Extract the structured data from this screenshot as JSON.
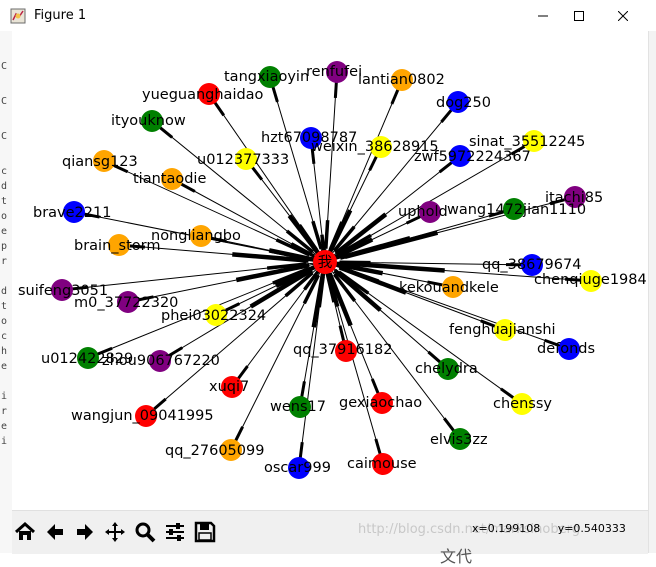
{
  "window": {
    "title": "Figure 1",
    "controls": {
      "minimize": "minimize",
      "maximize": "maximize",
      "close": "close"
    }
  },
  "left_strip_chars": [
    "C",
    "C",
    "C",
    "c",
    "d",
    "t",
    "o",
    "e",
    "p",
    "r",
    "d",
    "t",
    "o",
    "c",
    "h",
    "e",
    "i",
    "r",
    "e",
    "i"
  ],
  "graph": {
    "center": {
      "label": "我",
      "color": "#ff0000"
    },
    "nodes": [
      {
        "label": "tangxiaoyin",
        "color": "#008000"
      },
      {
        "label": "renfufei",
        "color": "#800080"
      },
      {
        "label": "lantian0802",
        "color": "#ffa500"
      },
      {
        "label": "yueguanghaidao",
        "color": "#ff0000"
      },
      {
        "label": "dog250",
        "color": "#0000ff"
      },
      {
        "label": "ityouknow",
        "color": "#008000"
      },
      {
        "label": "hzt67098787",
        "color": "#0000ff"
      },
      {
        "label": "weixin_38628915",
        "color": "#ffff00"
      },
      {
        "label": "sinat_35512245",
        "color": "#ffff00"
      },
      {
        "label": "u012377333",
        "color": "#ffff00"
      },
      {
        "label": "zwf5972224367",
        "color": "#0000ff"
      },
      {
        "label": "qiansg123",
        "color": "#ffa500"
      },
      {
        "label": "tiantaodie",
        "color": "#ffa500"
      },
      {
        "label": "itachi85",
        "color": "#800080"
      },
      {
        "label": "uphold",
        "color": "#800080"
      },
      {
        "label": "wang1472jian1110",
        "color": "#008000"
      },
      {
        "label": "brave2211",
        "color": "#0000ff"
      },
      {
        "label": "nongliangbo",
        "color": "#ffa500"
      },
      {
        "label": "brain_storm",
        "color": "#ffa500"
      },
      {
        "label": "qq_38679674",
        "color": "#0000ff"
      },
      {
        "label": "chenqiuge1984",
        "color": "#ffff00"
      },
      {
        "label": "suifeng3051",
        "color": "#800080"
      },
      {
        "label": "kekouandkele",
        "color": "#ffa500"
      },
      {
        "label": "m0_37722320",
        "color": "#800080"
      },
      {
        "label": "phei03022324",
        "color": "#ffff00"
      },
      {
        "label": "fenghuajianshi",
        "color": "#ffff00"
      },
      {
        "label": "defonds",
        "color": "#0000ff"
      },
      {
        "label": "u012422829",
        "color": "#008000"
      },
      {
        "label": "zhou906767220",
        "color": "#800080"
      },
      {
        "label": "qq_37916182",
        "color": "#ff0000"
      },
      {
        "label": "chelydra",
        "color": "#008000"
      },
      {
        "label": "xuqi7",
        "color": "#ff0000"
      },
      {
        "label": "chenssy",
        "color": "#ffff00"
      },
      {
        "label": "wens17",
        "color": "#008000"
      },
      {
        "label": "gexiaochao",
        "color": "#ff0000"
      },
      {
        "label": "wangjun_09041995",
        "color": "#ff0000"
      },
      {
        "label": "elvis3zz",
        "color": "#008000"
      },
      {
        "label": "qq_27605099",
        "color": "#ffa500"
      },
      {
        "label": "caimouse",
        "color": "#ff0000"
      },
      {
        "label": "oscar999",
        "color": "#0000ff"
      }
    ]
  },
  "toolbar": {
    "buttons": [
      "home-icon",
      "back-icon",
      "forward-icon",
      "pan-icon",
      "zoom-icon",
      "configure-subplots-icon",
      "save-icon"
    ]
  },
  "status": {
    "x": "x=0.199108",
    "y": "y=0.540333"
  },
  "watermark": "http://blog.csdn.net/marksinoberg",
  "below_char": "文代"
}
